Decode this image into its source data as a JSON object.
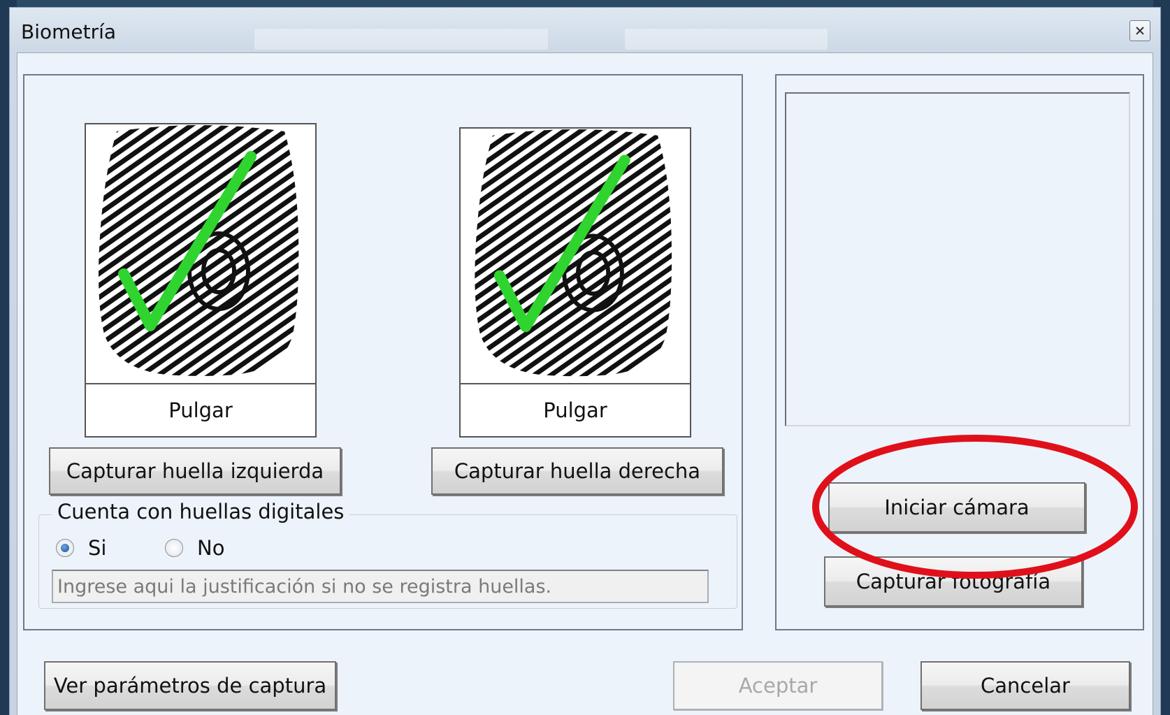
{
  "window": {
    "title": "Biometría"
  },
  "left_print": {
    "label": "Pulgar",
    "capture_label": "Capturar huella izquierda"
  },
  "right_print": {
    "label": "Pulgar",
    "capture_label": "Capturar huella derecha"
  },
  "fingerprints_group": {
    "legend": "Cuenta con huellas digitales",
    "options": [
      {
        "label": "Si",
        "checked": true
      },
      {
        "label": "No",
        "checked": false
      }
    ],
    "justification_placeholder": "Ingrese aqui la justificación si no se registra huellas."
  },
  "camera": {
    "start_label": "Iniciar cámara",
    "capture_photo_label": "Capturar fotografía"
  },
  "footer": {
    "params_label": "Ver parámetros de captura",
    "accept_label": "Aceptar",
    "accept_enabled": false,
    "cancel_label": "Cancelar"
  },
  "colors": {
    "highlight": "#e0101a",
    "checkmark": "#2fd42f"
  }
}
